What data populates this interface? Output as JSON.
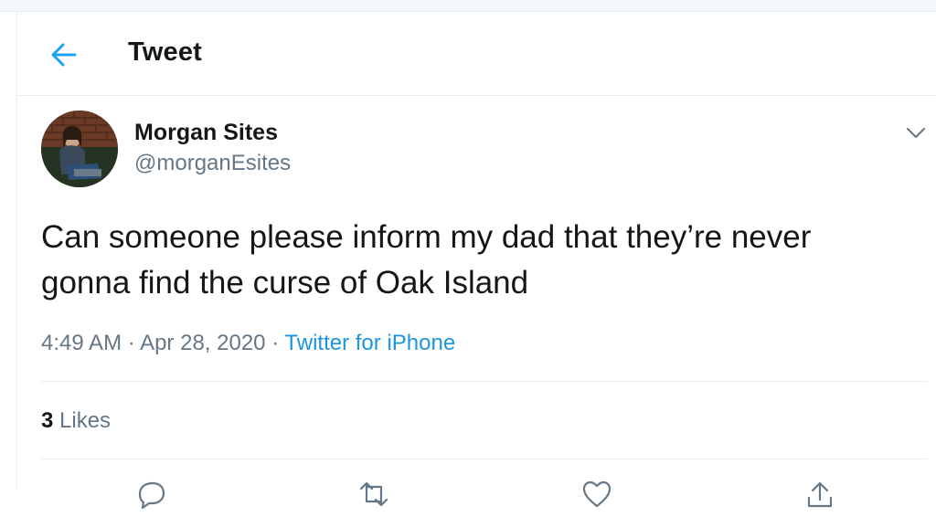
{
  "header": {
    "title": "Tweet",
    "back_icon": "arrow-left-icon",
    "accent_color": "#1da1f2"
  },
  "tweet": {
    "display_name": "Morgan Sites",
    "handle": "@morganEsites",
    "text": "Can someone please inform my dad that they’re never gonna find the curse of Oak Island",
    "time": "4:49 AM",
    "separator": "·",
    "date": "Apr 28, 2020",
    "source": "Twitter for iPhone",
    "menu_icon": "chevron-down-icon"
  },
  "stats": {
    "likes_count": "3",
    "likes_label": "Likes"
  },
  "actions": [
    "reply-icon",
    "retweet-icon",
    "like-icon",
    "share-icon"
  ],
  "colors": {
    "link": "#1b95e0",
    "secondary_text": "#657786",
    "primary_text": "#14171a",
    "border": "#e6ecf0"
  }
}
